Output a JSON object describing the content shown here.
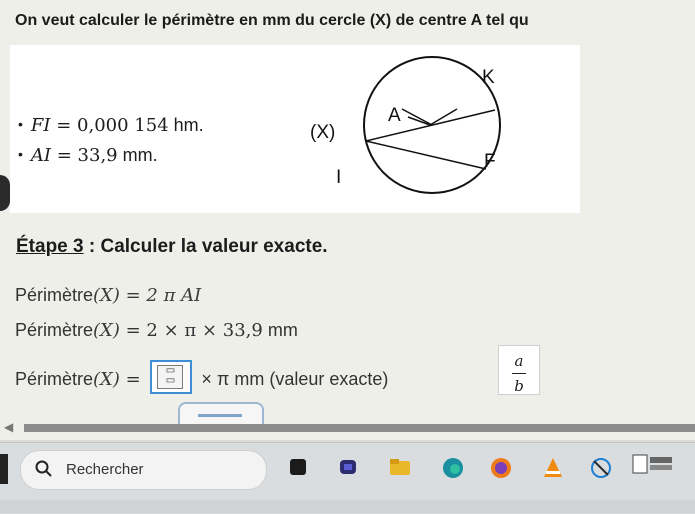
{
  "problem": {
    "text": "On veut calculer le périmètre en mm du cercle (X) de centre A tel qu"
  },
  "givens": [
    {
      "lhs": "FI",
      "eq": " = ",
      "value": "0,000 154",
      "unit": " hm."
    },
    {
      "lhs": "AI",
      "eq": " = ",
      "value": "33,9",
      "unit": " mm."
    }
  ],
  "diagram": {
    "circle": "(X)",
    "labels": {
      "K": "K",
      "A": "A",
      "F": "F",
      "I": "I"
    }
  },
  "step": {
    "label": "Étape 3",
    "title": " : Calculer la valeur exacte."
  },
  "lines": {
    "l1_label": "Périmètre",
    "l1_arg": "(X)",
    "l1_math": " = 2 π AI",
    "l2_label": "Périmètre",
    "l2_arg": "(X)",
    "l2_math": " = 2 × π × 33,9",
    "l2_unit": " mm",
    "l3_label": "Périmètre",
    "l3_arg": "(X)",
    "l3_eq": " = ",
    "l3_after": " × π mm (valeur exacte)"
  },
  "fraction_button": {
    "num": "a",
    "den": "b"
  },
  "taskbar": {
    "search_placeholder": "Rechercher"
  },
  "colors": {
    "accent": "#3d8fd6",
    "panel": "#ffffff",
    "taskbar": "#d9dde0"
  }
}
